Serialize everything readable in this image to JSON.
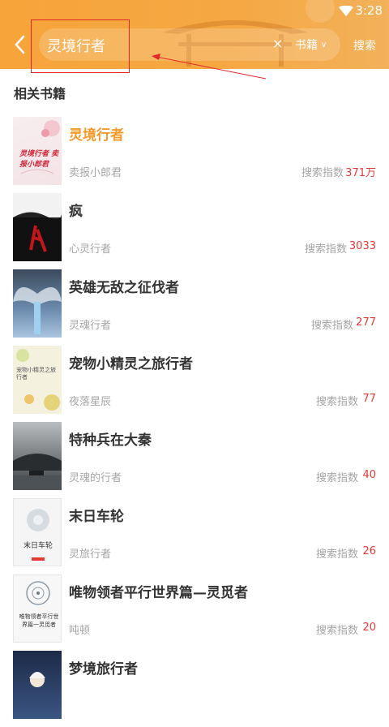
{
  "status": {
    "time": "3:28"
  },
  "header": {
    "search_query": "灵境行者",
    "clear": "×",
    "category": "书籍",
    "search_label": "搜索"
  },
  "section_title": "相关书籍",
  "books": [
    {
      "title": "灵境行者",
      "author": "卖报小郎君",
      "index_label": "搜索指数",
      "index_value": "371万",
      "cover_text": "灵境行者 卖报小郎君"
    },
    {
      "title": "疯",
      "author": "心灵行者",
      "index_label": "搜索指数",
      "index_value": "3033"
    },
    {
      "title": "英雄无敌之征伐者",
      "author": "灵魂行者",
      "index_label": "搜索指数",
      "index_value": "277"
    },
    {
      "title": "宠物小精灵之旅行者",
      "author": "夜落星辰",
      "index_label": "搜索指数",
      "index_value": "77",
      "cover_text": "宠物小精灵之旅行者"
    },
    {
      "title": "特种兵在大秦",
      "author": "灵魂的行者",
      "index_label": "搜索指数",
      "index_value": "40"
    },
    {
      "title": "末日车轮",
      "author": "灵旅行者",
      "index_label": "搜索指数",
      "index_value": "26",
      "cover_text": "末日车轮"
    },
    {
      "title": "唯物领者平行世界篇—灵觅者",
      "author": "吨顿",
      "index_label": "搜索指数",
      "index_value": "20",
      "cover_text": "唯物领者平行世界篇一灵觅者"
    },
    {
      "title": "梦境旅行者",
      "author": "",
      "index_label": "",
      "index_value": ""
    }
  ],
  "colors": {
    "accent": "#f5a23b",
    "highlight": "#f39a2b",
    "index_red": "#e23a37",
    "annotation": "#e0282c"
  }
}
